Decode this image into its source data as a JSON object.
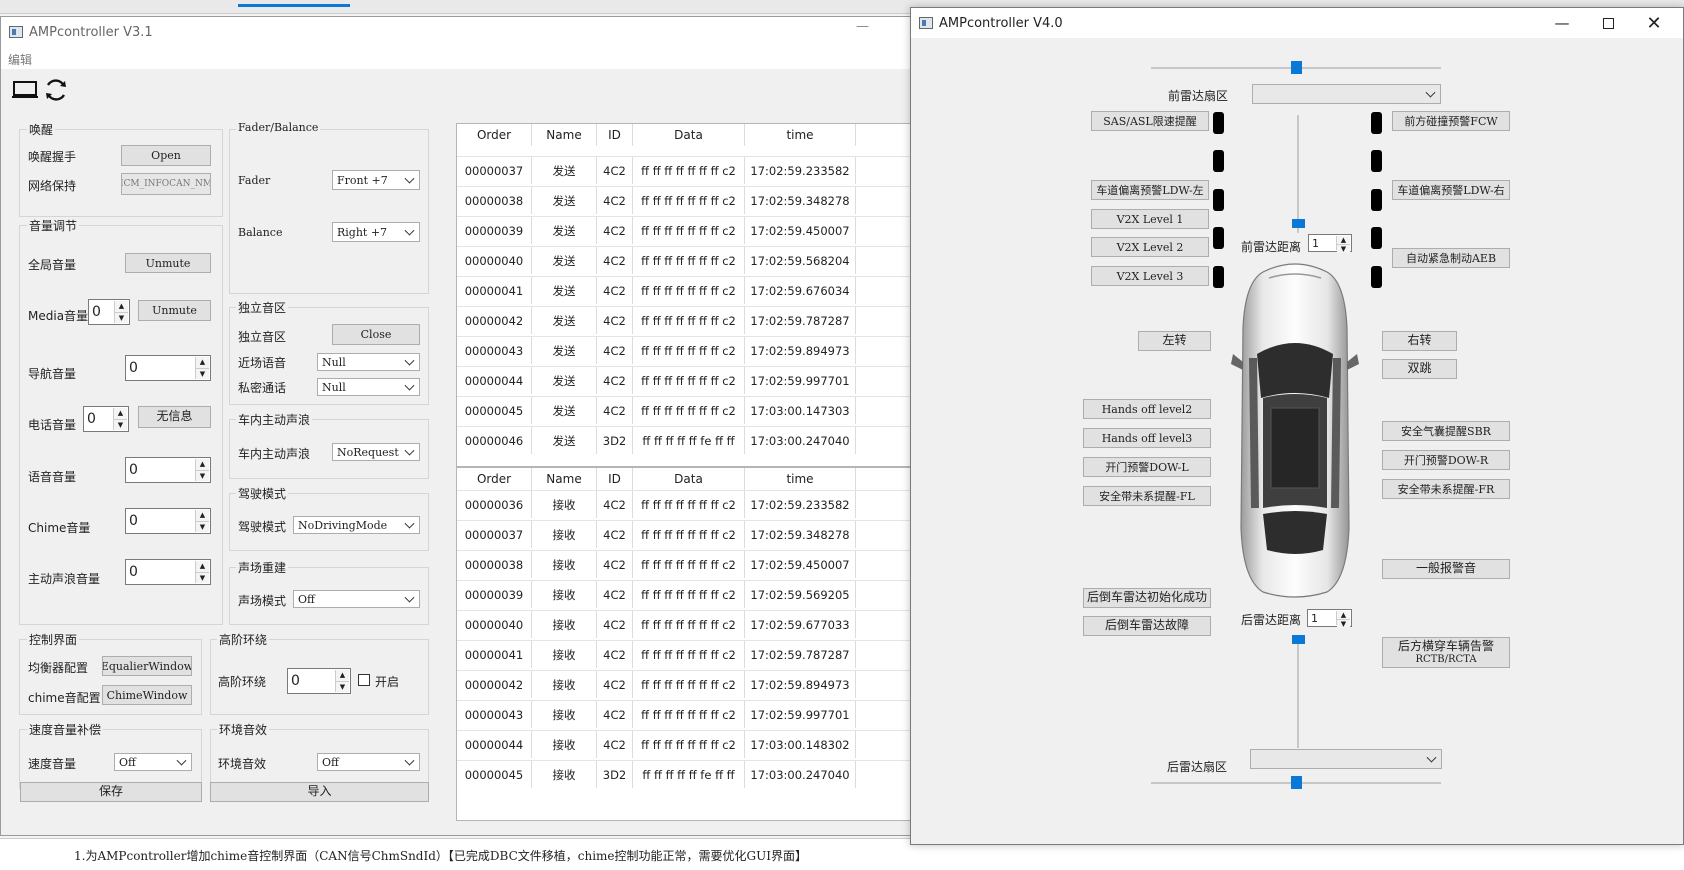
{
  "colors": {
    "accent": "#0a78d7",
    "led": "#000000"
  },
  "icons": {
    "monitor": "monitor-icon",
    "refresh": "refresh-icon"
  },
  "v31": {
    "title": "AMPcontroller V3.1",
    "menu": "编辑",
    "wake": {
      "title": "唤醒",
      "handshake_label": "唤醒握手",
      "handshake_btn": "Open",
      "keepalive_label": "网络保持",
      "keepalive_btn": "ICM_INFOCAN_NM"
    },
    "volume": {
      "title": "音量调节",
      "global_label": "全局音量",
      "global_btn": "Unmute",
      "media_label": "Media音量",
      "media_value": "0",
      "media_btn": "Unmute",
      "nav_label": "导航音量",
      "nav_value": "0",
      "phone_label": "电话音量",
      "phone_value": "0",
      "phone_btn": "无信息",
      "voice_label": "语音音量",
      "voice_value": "0",
      "chime_label": "Chime音量",
      "chime_value": "0",
      "anc_label": "主动声浪音量",
      "anc_value": "0"
    },
    "fader": {
      "title": "Fader/Balance",
      "fader_label": "Fader",
      "fader_value": "Front +7",
      "balance_label": "Balance",
      "balance_value": "Right +7"
    },
    "zone": {
      "title": "独立音区",
      "zone_label": "独立音区",
      "zone_btn": "Close",
      "near_label": "近场语音",
      "near_value": "Null",
      "private_label": "私密通话",
      "private_value": "Null"
    },
    "anc": {
      "title": "车内主动声浪",
      "label": "车内主动声浪",
      "value": "NoRequest"
    },
    "drive": {
      "title": "驾驶模式",
      "label": "驾驶模式",
      "value": "NoDrivingMode"
    },
    "soundfield": {
      "title": "声场重建",
      "label": "声场模式",
      "value": "Off"
    },
    "control": {
      "title": "控制界面",
      "eq_label": "均衡器配置",
      "eq_btn": "EqualierWindow",
      "chime_label": "chime音配置",
      "chime_btn": "ChimeWindow"
    },
    "hiorder": {
      "title": "高阶环绕",
      "label": "高阶环绕",
      "value": "0",
      "check_label": "开启"
    },
    "speed": {
      "title": "速度音量补偿",
      "label": "速度音量",
      "value": "Off"
    },
    "ambient": {
      "title": "环境音效",
      "label": "环境音效",
      "value": "Off"
    },
    "save_btn": "保存",
    "import_btn": "导入",
    "table_headers": [
      "Order",
      "Name",
      "ID",
      "Data",
      "time"
    ],
    "send_rows": [
      [
        "00000037",
        "发送",
        "4C2",
        "ff ff ff ff ff ff ff c2",
        "17:02:59.233582"
      ],
      [
        "00000038",
        "发送",
        "4C2",
        "ff ff ff ff ff ff ff c2",
        "17:02:59.348278"
      ],
      [
        "00000039",
        "发送",
        "4C2",
        "ff ff ff ff ff ff ff c2",
        "17:02:59.450007"
      ],
      [
        "00000040",
        "发送",
        "4C2",
        "ff ff ff ff ff ff ff c2",
        "17:02:59.568204"
      ],
      [
        "00000041",
        "发送",
        "4C2",
        "ff ff ff ff ff ff ff c2",
        "17:02:59.676034"
      ],
      [
        "00000042",
        "发送",
        "4C2",
        "ff ff ff ff ff ff ff c2",
        "17:02:59.787287"
      ],
      [
        "00000043",
        "发送",
        "4C2",
        "ff ff ff ff ff ff ff c2",
        "17:02:59.894973"
      ],
      [
        "00000044",
        "发送",
        "4C2",
        "ff ff ff ff ff ff ff c2",
        "17:02:59.997701"
      ],
      [
        "00000045",
        "发送",
        "4C2",
        "ff ff ff ff ff ff ff c2",
        "17:03:00.147303"
      ],
      [
        "00000046",
        "发送",
        "3D2",
        "ff ff ff ff ff fe ff ff",
        "17:03:00.247040"
      ]
    ],
    "recv_rows": [
      [
        "00000036",
        "接收",
        "4C2",
        "ff ff ff ff ff ff ff c2",
        "17:02:59.233582"
      ],
      [
        "00000037",
        "接收",
        "4C2",
        "ff ff ff ff ff ff ff c2",
        "17:02:59.348278"
      ],
      [
        "00000038",
        "接收",
        "4C2",
        "ff ff ff ff ff ff ff c2",
        "17:02:59.450007"
      ],
      [
        "00000039",
        "接收",
        "4C2",
        "ff ff ff ff ff ff ff c2",
        "17:02:59.569205"
      ],
      [
        "00000040",
        "接收",
        "4C2",
        "ff ff ff ff ff ff ff c2",
        "17:02:59.677033"
      ],
      [
        "00000041",
        "接收",
        "4C2",
        "ff ff ff ff ff ff ff c2",
        "17:02:59.787287"
      ],
      [
        "00000042",
        "接收",
        "4C2",
        "ff ff ff ff ff ff ff c2",
        "17:02:59.894973"
      ],
      [
        "00000043",
        "接收",
        "4C2",
        "ff ff ff ff ff ff ff c2",
        "17:02:59.997701"
      ],
      [
        "00000044",
        "接收",
        "4C2",
        "ff ff ff ff ff ff ff c2",
        "17:03:00.148302"
      ],
      [
        "00000045",
        "接收",
        "3D2",
        "ff ff ff ff ff fe ff ff",
        "17:03:00.247040"
      ]
    ]
  },
  "v40": {
    "title": "AMPcontroller V4.0",
    "front_zone_label": "前雷达扇区",
    "front_zone_value": "",
    "front_distance_label": "前雷达距离",
    "front_distance_value": "1",
    "rear_distance_label": "后雷达距离",
    "rear_distance_value": "1",
    "rear_zone_label": "后雷达扇区",
    "rear_zone_value": "",
    "left_buttons": {
      "sas": "SAS/ASL限速提醒",
      "ldw_left": "车道偏离预警LDW-左",
      "v2x1": "V2X Level 1",
      "v2x2": "V2X Level 2",
      "v2x3": "V2X Level 3",
      "turn_left": "左转",
      "hands2": "Hands off level2",
      "hands3": "Hands off level3",
      "dow_l": "开门预警DOW-L",
      "belt_fl": "安全带未系提醒-FL",
      "rear_init": "后倒车雷达初始化成功",
      "rear_fault": "后倒车雷达故障"
    },
    "right_buttons": {
      "fcw": "前方碰撞预警FCW",
      "ldw_right": "车道偏离预警LDW-右",
      "aeb": "自动紧急制动AEB",
      "turn_right": "右转",
      "hazard": "双跳",
      "sbr": "安全气囊提醒SBR",
      "dow_r": "开门预警DOW-R",
      "belt_fr": "安全带未系提醒-FR",
      "general": "一般报警音",
      "rctb_1": "后方横穿车辆告警",
      "rctb_2": "RCTB/RCTA"
    }
  },
  "taskbar_text": "1.为AMPcontroller增加chime音控制界面（CAN信号ChmSndId）【已完成DBC文件移植，chime控制功能正常，需要优化GUI界面】"
}
